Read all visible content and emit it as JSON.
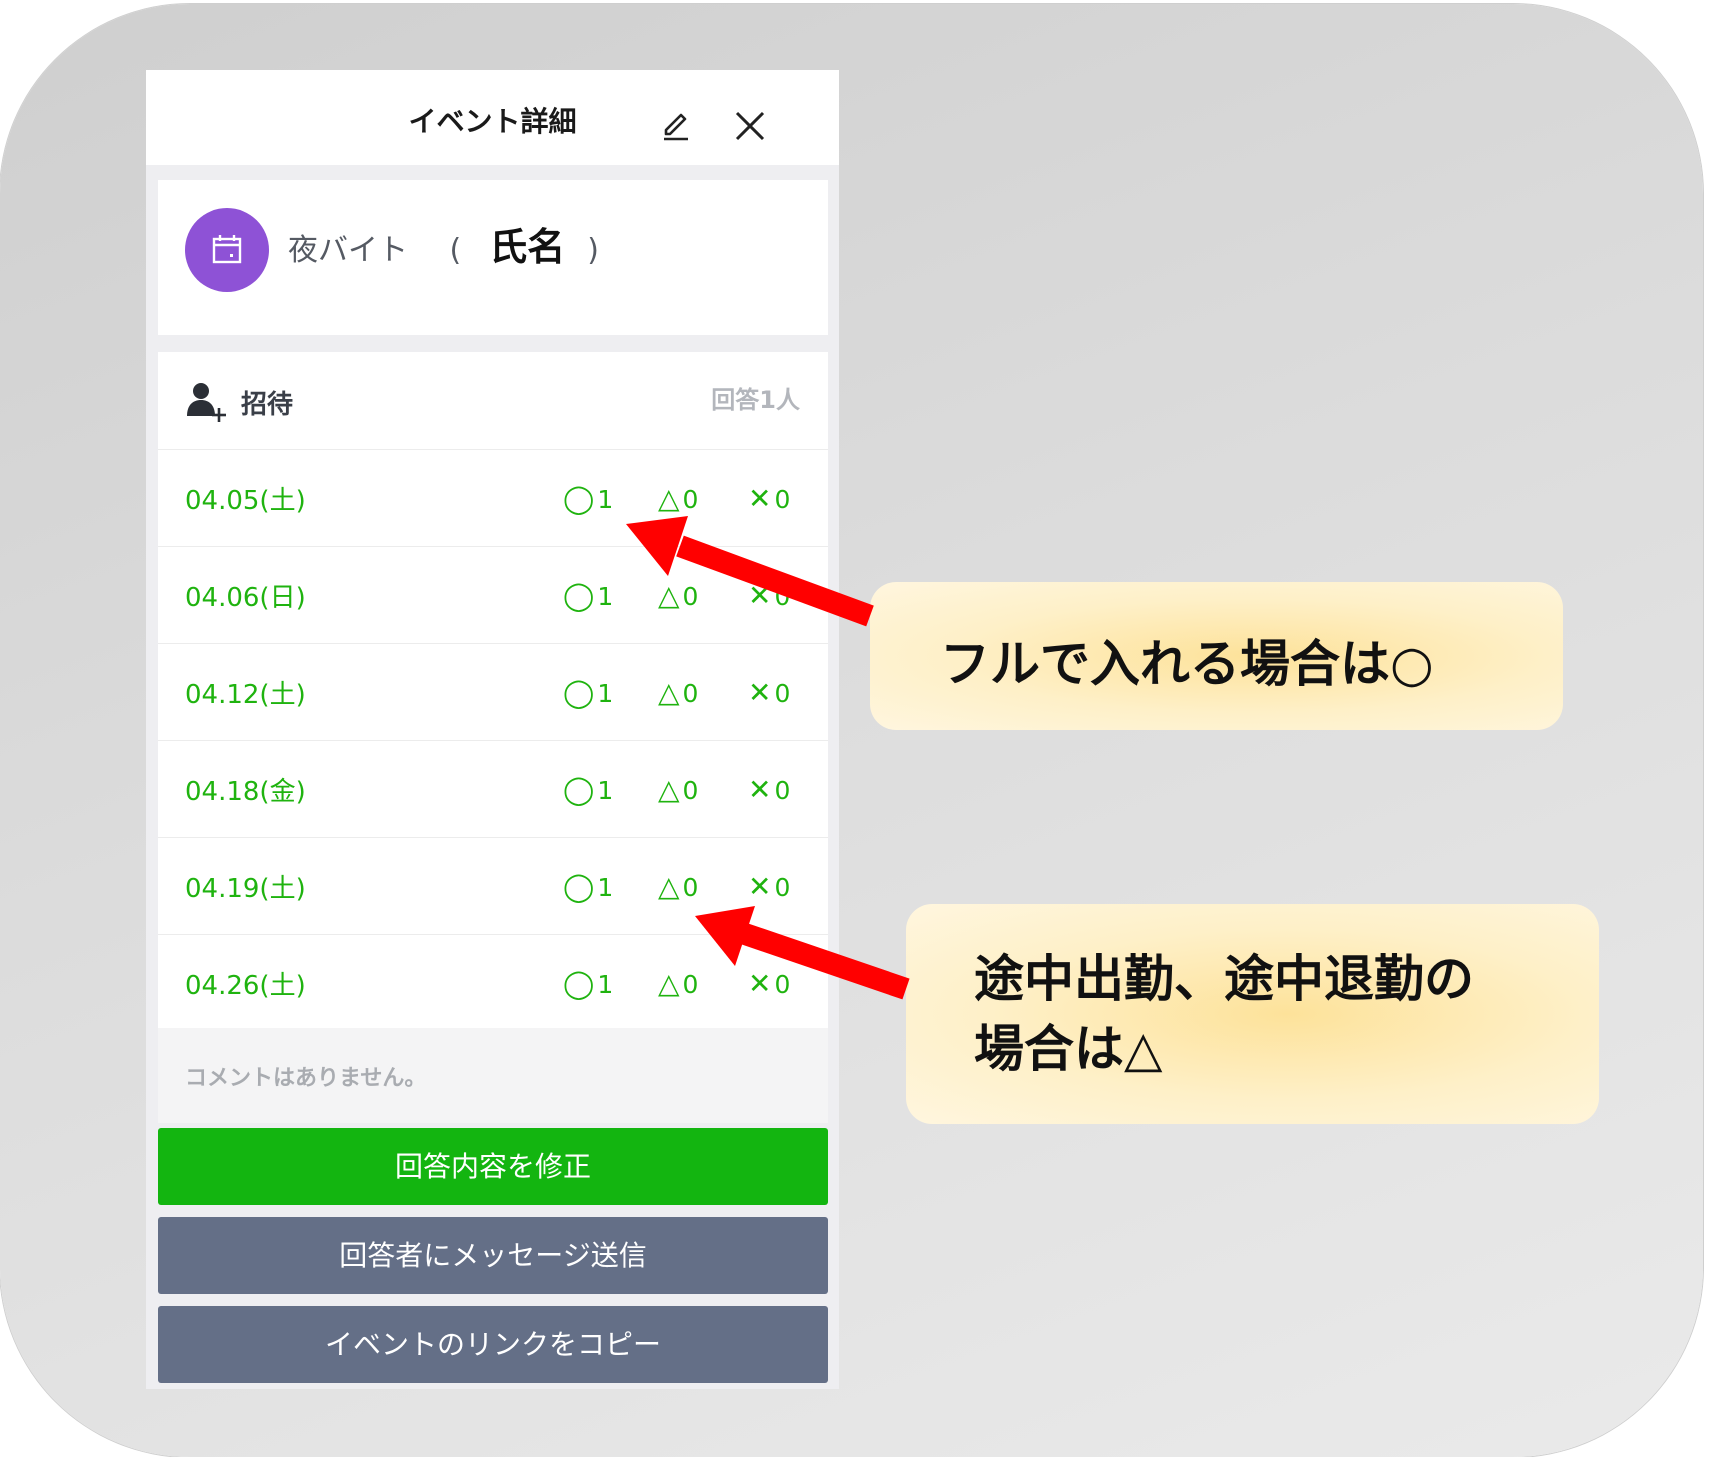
{
  "header": {
    "title": "イベント詳細"
  },
  "event": {
    "prefix": "夜バイト",
    "open_paren": "(",
    "name": "氏名",
    "close_paren": ")"
  },
  "invite": {
    "label": "招待",
    "reply_count": "回答1人",
    "marks": {
      "circle": "◯",
      "triangle": "△",
      "cross": "✕"
    },
    "rows": [
      {
        "date": "04.05(土)",
        "circle": "1",
        "triangle": "0",
        "cross": "0"
      },
      {
        "date": "04.06(日)",
        "circle": "1",
        "triangle": "0",
        "cross": "0"
      },
      {
        "date": "04.12(土)",
        "circle": "1",
        "triangle": "0",
        "cross": "0"
      },
      {
        "date": "04.18(金)",
        "circle": "1",
        "triangle": "0",
        "cross": "0"
      },
      {
        "date": "04.19(土)",
        "circle": "1",
        "triangle": "0",
        "cross": "0"
      },
      {
        "date": "04.26(土)",
        "circle": "1",
        "triangle": "0",
        "cross": "0"
      }
    ],
    "comment": "コメントはありません。"
  },
  "buttons": {
    "edit_answer": "回答内容を修正",
    "message_responders": "回答者にメッセージ送信",
    "copy_link": "イベントのリンクをコピー"
  },
  "annotations": {
    "full": "フルで入れる場合は○",
    "partial_line1": "途中出勤、途中退勤の",
    "partial_line2": "場合は△"
  },
  "colors": {
    "accent_green": "#13b510",
    "mark_green": "#1fb30f",
    "button_gray": "#646f87",
    "avatar_purple": "#8e52d6",
    "arrow_red": "#ff0000",
    "callout_yellow": "#fde29a"
  },
  "icons": {
    "edit": "pencil-icon",
    "close": "close-icon",
    "avatar": "calendar-icon",
    "invite": "add-person-icon"
  }
}
